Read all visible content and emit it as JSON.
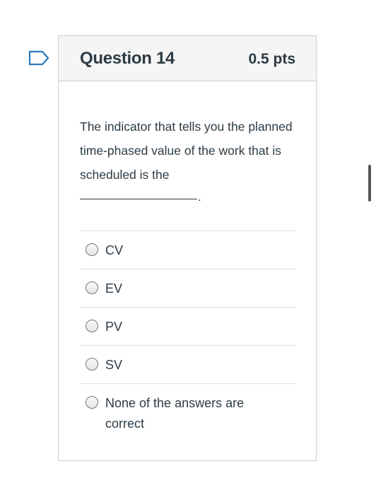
{
  "question": {
    "title": "Question 14",
    "points": "0.5 pts",
    "text": "The indicator that tells you the planned time-phased value of the work that is scheduled is the",
    "blank_suffix": "."
  },
  "answers": [
    {
      "label": "CV",
      "selected": false
    },
    {
      "label": "EV",
      "selected": false
    },
    {
      "label": "PV",
      "selected": false
    },
    {
      "label": "SV",
      "selected": false
    },
    {
      "label": "None of the answers are correct",
      "selected": false
    }
  ],
  "icons": {
    "flag": "flag-icon"
  },
  "colors": {
    "flag_outline": "#2b7abc",
    "header_background": "#f5f5f5",
    "text": "#2d3b45",
    "border": "#c7cdd1"
  }
}
